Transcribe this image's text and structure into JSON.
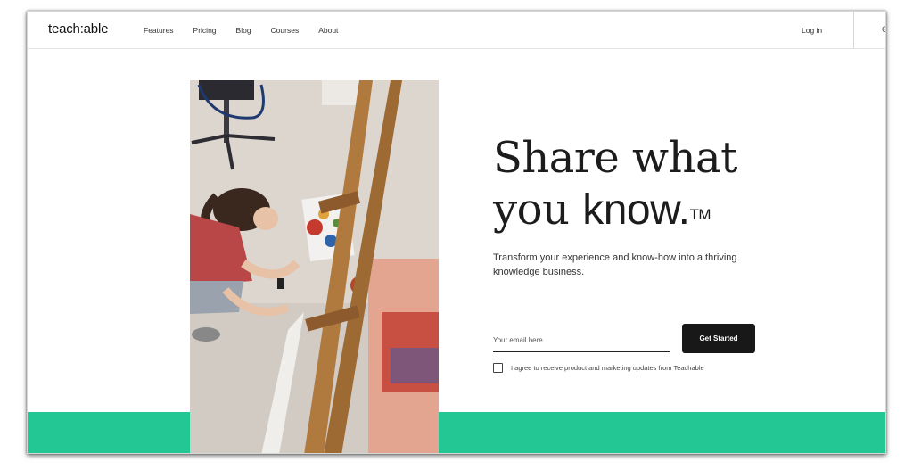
{
  "header": {
    "logo_text": "teach:able",
    "nav_links": [
      "Features",
      "Pricing",
      "Blog",
      "Courses",
      "About"
    ],
    "login_label": "Log in",
    "cutoff_char": "G"
  },
  "hero": {
    "headline_line1": "Share what",
    "headline_you": "you ",
    "headline_know": "know.",
    "headline_tm": "TM",
    "subtext": "Transform your experience and know-how into a thriving knowledge business.",
    "email_placeholder": "Your email here",
    "cta_label": "Get Started",
    "consent_label": "I agree to receive product and marketing updates from Teachable",
    "consent_checked": false
  },
  "colors": {
    "accent_green": "#22c794",
    "cta_background": "#181818"
  }
}
